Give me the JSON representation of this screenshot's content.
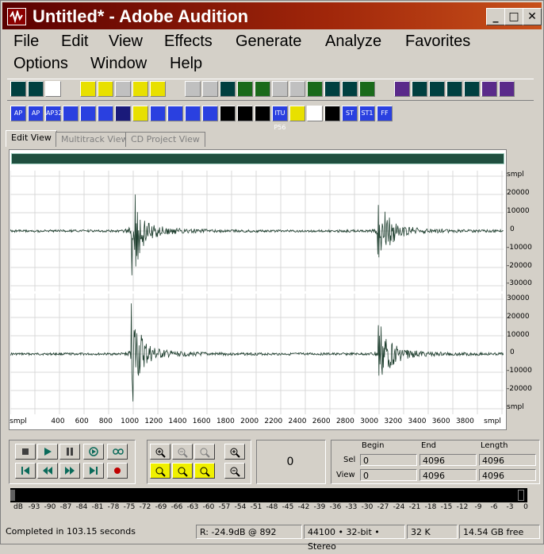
{
  "window": {
    "title": "Untitled* - Adobe Audition",
    "min_glyph": "_",
    "max_glyph": "□",
    "close_glyph": "✕"
  },
  "menu": [
    "File",
    "Edit",
    "View",
    "Effects",
    "Generate",
    "Analyze",
    "Favorites",
    "Options",
    "Window",
    "Help"
  ],
  "tabs": [
    {
      "label": "Edit View",
      "active": true
    },
    {
      "label": "Multitrack View",
      "active": false
    },
    {
      "label": "CD Project View",
      "active": false
    }
  ],
  "toolbar_icons_row1": [
    "waveform-icon",
    "spectral-icon",
    "cd-icon",
    "new-icon",
    "open-icon",
    "save-icon",
    "save-all-icon",
    "open-as-icon",
    "undo-icon",
    "redo-icon",
    "cut-icon",
    "copy-icon",
    "paste-icon",
    "scissors-icon",
    "paste-new-icon",
    "mix-paste-icon",
    "trim-icon",
    "insert-icon",
    "record-icon",
    "amplify-icon",
    "dynamics-icon",
    "noise-icon",
    "noise-reduce-icon",
    "pitch-icon",
    "reverb-icon",
    "echo-icon"
  ],
  "toolbar_icons_row2": [
    "ap-icon",
    "ap2-icon",
    "ap32-icon",
    "noise-gate-icon",
    "wave-icon",
    "wave2-icon",
    "normalize-icon",
    "filter-icon",
    "filter2-icon",
    "eq-icon",
    "graphic-eq-icon",
    "pan-icon",
    "kx1-icon",
    "kx2-icon",
    "kx3-icon",
    "itu-icon",
    "sun-icon",
    "palette-icon",
    "night-icon",
    "st-icon",
    "st1-icon",
    "ff-icon"
  ],
  "toolbar_text_row2": {
    "ap": "AP",
    "ap_alt": "AP",
    "ap32": "AP32",
    "itu": "ITU P56",
    "st": "ST",
    "st1": "ST1",
    "ff": "FF"
  },
  "wave": {
    "y_unit": "smpl",
    "top_labels": [
      "smpl",
      "20000",
      "10000",
      "0",
      "-10000",
      "-20000",
      "-30000"
    ],
    "bottom_labels": [
      "30000",
      "20000",
      "10000",
      "0",
      "-10000",
      "-20000",
      "smpl"
    ],
    "x_labels": [
      "smpl",
      "400",
      "600",
      "800",
      "1000",
      "1200",
      "1400",
      "1600",
      "1800",
      "2000",
      "2200",
      "2400",
      "2600",
      "2800",
      "3000",
      "3200",
      "3400",
      "3600",
      "3800",
      "smpl"
    ]
  },
  "time_display": "0",
  "selection": {
    "headers": {
      "begin": "Begin",
      "end": "End",
      "length": "Length"
    },
    "sel": {
      "label": "Sel",
      "begin": "0",
      "end": "4096",
      "length": "4096"
    },
    "view": {
      "label": "View",
      "begin": "0",
      "end": "4096",
      "length": "4096"
    }
  },
  "meter_scale": [
    "dB",
    "-93",
    "-90",
    "-87",
    "-84",
    "-81",
    "-78",
    "-75",
    "-72",
    "-69",
    "-66",
    "-63",
    "-60",
    "-57",
    "-54",
    "-51",
    "-48",
    "-45",
    "-42",
    "-39",
    "-36",
    "-33",
    "-30",
    "-27",
    "-24",
    "-21",
    "-18",
    "-15",
    "-12",
    "-9",
    "-6",
    "-3",
    "0"
  ],
  "status": {
    "message": "Completed in 103.15 seconds",
    "cursor": "R: -24.9dB @ 892",
    "format": "44100 • 32-bit • Stereo",
    "size": "32 K",
    "free": "14.54 GB free"
  },
  "colors": {
    "wave": "#1f3f2f",
    "grid": "#d8d8d8",
    "title_start": "#5a0000",
    "title_end": "#c8501a"
  }
}
